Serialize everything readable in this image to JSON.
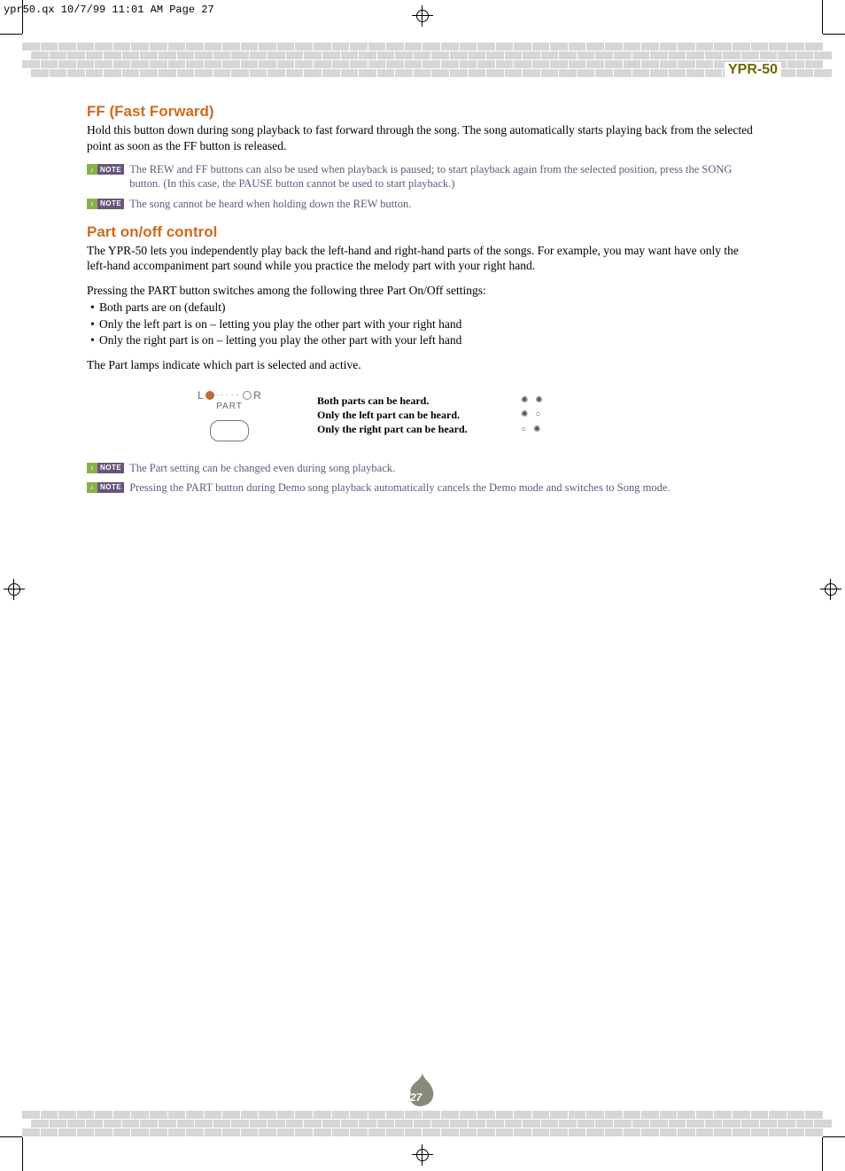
{
  "file_header": "ypr50.qx  10/7/99  11:01 AM  Page 27",
  "model_label": "YPR-50",
  "page_number": "27",
  "section_ff": {
    "title": "FF (Fast Forward)",
    "body": "Hold this button down during song playback to fast forward through the song.  The song automatically starts playing back from the selected point as soon as the FF button is released.",
    "note1": "The REW and FF buttons can also be used when playback is paused; to start playback again from the selected position, press the SONG button.  (In this case, the PAUSE button cannot be used to start playback.)",
    "note2": "The song cannot be heard when holding down the REW button."
  },
  "section_part": {
    "title": "Part on/off control",
    "body1": "The YPR-50 lets you independently play back the left-hand and right-hand parts of the songs.  For example, you may want have only the left-hand accompaniment part sound while you practice the melody part with your right hand.",
    "body2": "Pressing the PART button switches among the following three Part On/Off settings:",
    "bullets": [
      "Both parts are on (default)",
      "Only the left part is on – letting you play the other part with your right hand",
      "Only the right part is on – letting you play the other part with your left hand"
    ],
    "body3": "The Part lamps indicate which part is selected and active.",
    "icon": {
      "L": "L",
      "R": "R",
      "label": "PART"
    },
    "lamp_table": [
      {
        "desc": "Both parts can be heard.",
        "left": "on",
        "right": "on"
      },
      {
        "desc": "Only the left part can be heard.",
        "left": "on",
        "right": "off"
      },
      {
        "desc": "Only the right part can be heard.",
        "left": "off",
        "right": "on"
      }
    ],
    "note3": "The Part setting can be changed even during song playback.",
    "note4": "Pressing the PART button during Demo song playback automatically cancels the Demo mode and switches to Song mode."
  },
  "note_badge": {
    "music": "♪",
    "text": "NOTE"
  }
}
